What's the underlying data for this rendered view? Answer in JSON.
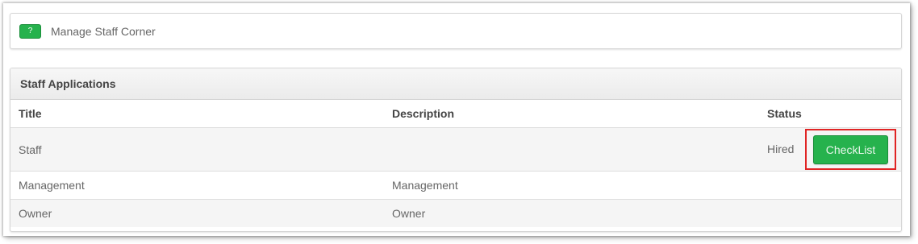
{
  "help": {
    "button_label": "?",
    "title": "Manage Staff Corner"
  },
  "applications": {
    "panel_title": "Staff Applications",
    "columns": [
      "Title",
      "Description",
      "Status"
    ],
    "rows": [
      {
        "title": "Staff",
        "description": "",
        "status": "Hired",
        "action": "CheckList"
      },
      {
        "title": "Management",
        "description": "Management",
        "status": "",
        "action": ""
      },
      {
        "title": "Owner",
        "description": "Owner",
        "status": "",
        "action": ""
      }
    ]
  },
  "colors": {
    "button_green": "#26b24d",
    "highlight_red": "#e02424"
  }
}
